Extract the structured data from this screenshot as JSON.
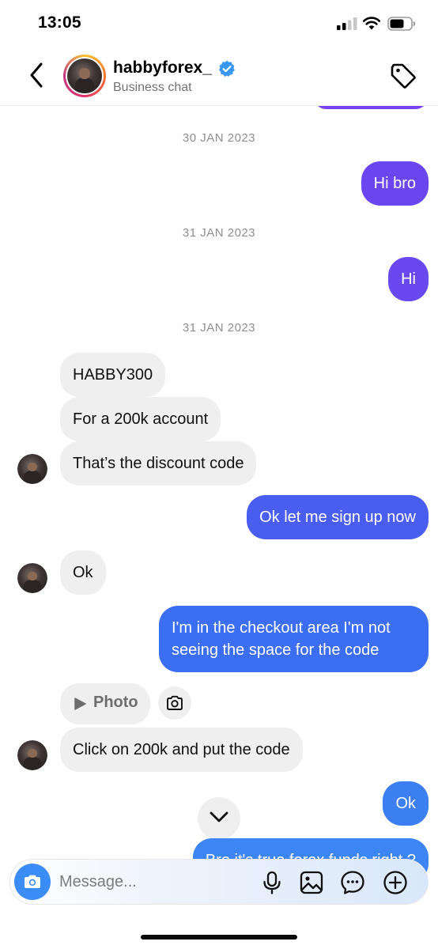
{
  "status_bar": {
    "time": "13:05"
  },
  "header": {
    "username": "habbyforex_",
    "subtitle": "Business chat"
  },
  "messages": [
    {
      "kind": "date",
      "text": "30 JAN 2023"
    },
    {
      "kind": "outgoing",
      "text": "Hi bro"
    },
    {
      "kind": "date",
      "text": "31 JAN 2023"
    },
    {
      "kind": "outgoing",
      "text": "Hi"
    },
    {
      "kind": "date",
      "text": "31 JAN 2023"
    },
    {
      "kind": "incoming",
      "text": "HABBY300"
    },
    {
      "kind": "incoming",
      "text": "For a 200k account"
    },
    {
      "kind": "incoming",
      "text": "That’s the discount code"
    },
    {
      "kind": "outgoing",
      "text": "Ok let me sign up now"
    },
    {
      "kind": "incoming",
      "text": "Ok"
    },
    {
      "kind": "outgoing",
      "text": "I'm in the checkout area I'm not seeing the space for the code"
    },
    {
      "kind": "incoming-attachment",
      "text": "Photo"
    },
    {
      "kind": "incoming",
      "text": "Click on 200k and put the code"
    },
    {
      "kind": "outgoing",
      "text": "Ok"
    },
    {
      "kind": "outgoing",
      "text": "Bro it's true forex funds right ?"
    }
  ],
  "composer": {
    "placeholder": "Message..."
  },
  "colors": {
    "outgoing_purple": "#6b45f0",
    "outgoing_blue": "#3a6ef2",
    "incoming_bg": "#efefef",
    "verified_blue": "#3897f0",
    "camera_button": "#3b8cf7"
  },
  "icons": {
    "header": [
      "back-chevron-icon",
      "verified-badge-icon",
      "tag-icon"
    ],
    "chat": [
      "play-icon",
      "camera-icon",
      "chevron-down-icon"
    ],
    "composer": [
      "camera-icon",
      "microphone-icon",
      "gallery-icon",
      "sticker-chat-icon",
      "plus-circle-icon"
    ]
  }
}
